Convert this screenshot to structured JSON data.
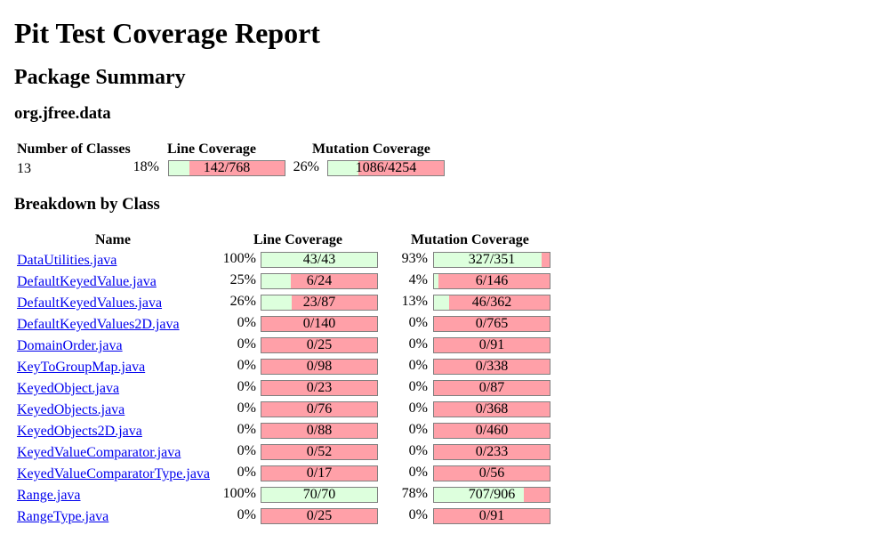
{
  "title": "Pit Test Coverage Report",
  "package_summary": {
    "heading": "Package Summary",
    "package_name": "org.jfree.data",
    "headers": {
      "classes": "Number of Classes",
      "line": "Line Coverage",
      "mutation": "Mutation Coverage"
    },
    "classes_count": "13",
    "line": {
      "pct": "18%",
      "label": "142/768",
      "fraction": 0.18
    },
    "mutation": {
      "pct": "26%",
      "label": "1086/4254",
      "fraction": 0.26
    }
  },
  "breakdown": {
    "heading": "Breakdown by Class",
    "headers": {
      "name": "Name",
      "line": "Line Coverage",
      "mutation": "Mutation Coverage"
    },
    "rows": [
      {
        "name": "DataUtilities.java",
        "line_pct": "100%",
        "line_label": "43/43",
        "line_fraction": 1.0,
        "mut_pct": "93%",
        "mut_label": "327/351",
        "mut_fraction": 0.93
      },
      {
        "name": "DefaultKeyedValue.java",
        "line_pct": "25%",
        "line_label": "6/24",
        "line_fraction": 0.25,
        "mut_pct": "4%",
        "mut_label": "6/146",
        "mut_fraction": 0.04
      },
      {
        "name": "DefaultKeyedValues.java",
        "line_pct": "26%",
        "line_label": "23/87",
        "line_fraction": 0.26,
        "mut_pct": "13%",
        "mut_label": "46/362",
        "mut_fraction": 0.13
      },
      {
        "name": "DefaultKeyedValues2D.java",
        "line_pct": "0%",
        "line_label": "0/140",
        "line_fraction": 0,
        "mut_pct": "0%",
        "mut_label": "0/765",
        "mut_fraction": 0
      },
      {
        "name": "DomainOrder.java",
        "line_pct": "0%",
        "line_label": "0/25",
        "line_fraction": 0,
        "mut_pct": "0%",
        "mut_label": "0/91",
        "mut_fraction": 0
      },
      {
        "name": "KeyToGroupMap.java",
        "line_pct": "0%",
        "line_label": "0/98",
        "line_fraction": 0,
        "mut_pct": "0%",
        "mut_label": "0/338",
        "mut_fraction": 0
      },
      {
        "name": "KeyedObject.java",
        "line_pct": "0%",
        "line_label": "0/23",
        "line_fraction": 0,
        "mut_pct": "0%",
        "mut_label": "0/87",
        "mut_fraction": 0
      },
      {
        "name": "KeyedObjects.java",
        "line_pct": "0%",
        "line_label": "0/76",
        "line_fraction": 0,
        "mut_pct": "0%",
        "mut_label": "0/368",
        "mut_fraction": 0
      },
      {
        "name": "KeyedObjects2D.java",
        "line_pct": "0%",
        "line_label": "0/88",
        "line_fraction": 0,
        "mut_pct": "0%",
        "mut_label": "0/460",
        "mut_fraction": 0
      },
      {
        "name": "KeyedValueComparator.java",
        "line_pct": "0%",
        "line_label": "0/52",
        "line_fraction": 0,
        "mut_pct": "0%",
        "mut_label": "0/233",
        "mut_fraction": 0
      },
      {
        "name": "KeyedValueComparatorType.java",
        "line_pct": "0%",
        "line_label": "0/17",
        "line_fraction": 0,
        "mut_pct": "0%",
        "mut_label": "0/56",
        "mut_fraction": 0
      },
      {
        "name": "Range.java",
        "line_pct": "100%",
        "line_label": "70/70",
        "line_fraction": 1.0,
        "mut_pct": "78%",
        "mut_label": "707/906",
        "mut_fraction": 0.78
      },
      {
        "name": "RangeType.java",
        "line_pct": "0%",
        "line_label": "0/25",
        "line_fraction": 0,
        "mut_pct": "0%",
        "mut_label": "0/91",
        "mut_fraction": 0
      }
    ]
  },
  "colors": {
    "covered": "#ddffdd",
    "uncovered": "#ffa0a8",
    "link": "#0000ee"
  }
}
